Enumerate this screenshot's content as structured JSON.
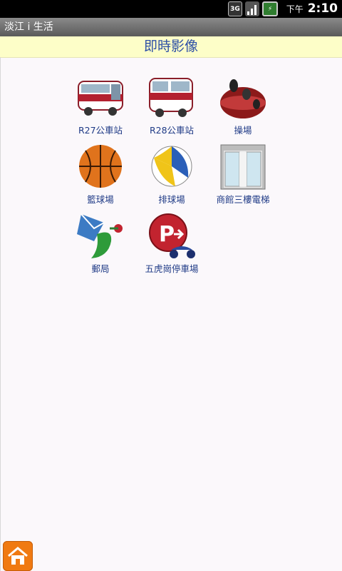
{
  "status_bar": {
    "network": "3G",
    "ampm": "下午",
    "time": "2:10"
  },
  "app": {
    "title": "淡江 i 生活"
  },
  "page": {
    "header": "即時影像"
  },
  "tiles": [
    {
      "label": "R27公車站",
      "icon": "bus-icon"
    },
    {
      "label": "R28公車站",
      "icon": "bus-icon"
    },
    {
      "label": "操場",
      "icon": "running-track-icon"
    },
    {
      "label": "籃球場",
      "icon": "basketball-icon"
    },
    {
      "label": "排球場",
      "icon": "volleyball-icon"
    },
    {
      "label": "商館三樓電梯",
      "icon": "elevator-icon"
    },
    {
      "label": "郵局",
      "icon": "post-office-icon"
    },
    {
      "label": "五虎崗停車場",
      "icon": "parking-icon"
    }
  ]
}
